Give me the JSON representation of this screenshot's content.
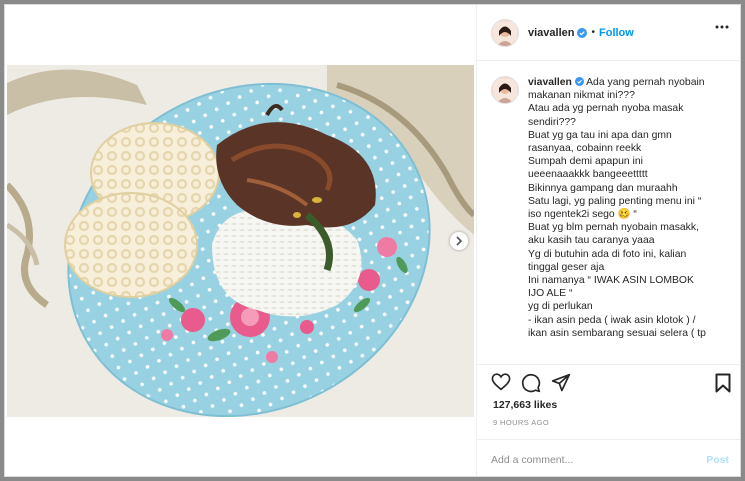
{
  "post": {
    "username": "viavallen",
    "follow_label": "Follow",
    "separator": "•",
    "caption_username": "viavallen",
    "caption_lines": [
      "Ada yang pernah nyobain",
      "makanan nikmat ini???",
      "Atau ada yg pernah nyoba masak",
      "sendiri???",
      "Buat yg ga tau ini apa dan gmn",
      "rasanyaa, cobainn reekk",
      "Sumpah demi apapun ini",
      "ueeenaaakkk bangeeettttt",
      "Bikinnya gampang dan muraahh",
      "Satu lagi, yg paling penting menu ini “",
      "iso ngentek2i sego 🥴 “",
      "Buat yg blm pernah nyobain masakk,",
      "aku kasih tau caranya yaaa",
      "Yg di butuhin ada di foto ini, kalian",
      "tinggal geser aja",
      "Ini namanya “ IWAK ASIN LOMBOK",
      "IJO ALE “",
      "yg di perlukan",
      "- ikan asin peda ( iwak asin klotok ) /",
      "ikan asin sembarang sesuai selera ( tp"
    ],
    "likes": "127,663 likes",
    "timestamp": "9 HOURS AGO",
    "comment_placeholder": "Add a comment...",
    "post_button": "Post"
  },
  "icons": {
    "verified": "verified-badge-icon",
    "more": "more-options-icon",
    "like": "heart-icon",
    "comment": "comment-icon",
    "share": "share-icon",
    "save": "bookmark-icon",
    "next": "chevron-right-icon"
  },
  "colors": {
    "link": "#0095f6",
    "text": "#262626",
    "muted": "#8e8e8e",
    "plate": "#9fd5e4"
  }
}
